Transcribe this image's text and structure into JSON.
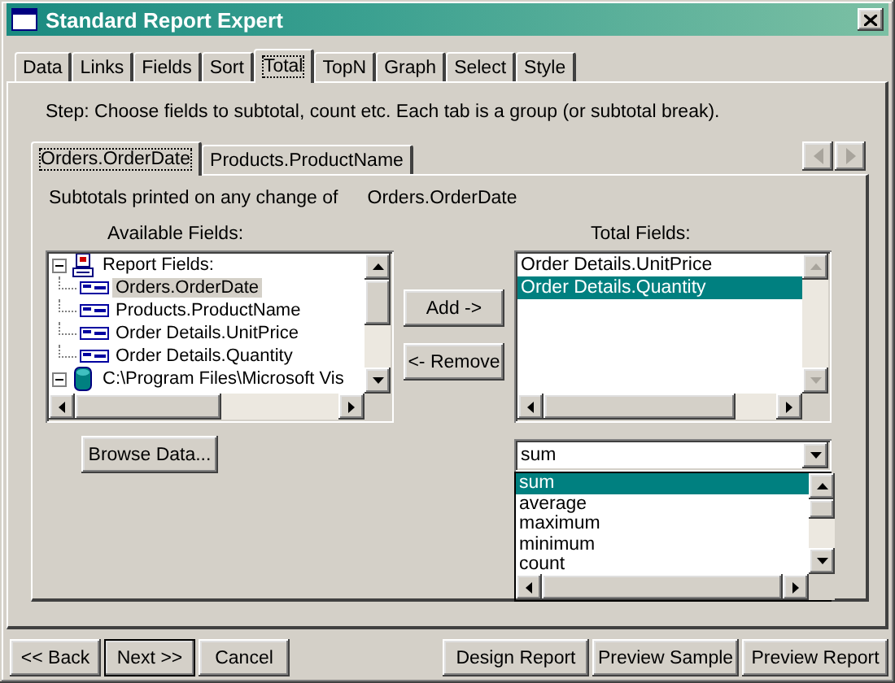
{
  "window": {
    "title": "Standard Report Expert"
  },
  "tabs": [
    {
      "label": "Data",
      "selected": false
    },
    {
      "label": "Links",
      "selected": false
    },
    {
      "label": "Fields",
      "selected": false
    },
    {
      "label": "Sort",
      "selected": false
    },
    {
      "label": "Total",
      "selected": true
    },
    {
      "label": "TopN",
      "selected": false
    },
    {
      "label": "Graph",
      "selected": false
    },
    {
      "label": "Select",
      "selected": false
    },
    {
      "label": "Style",
      "selected": false
    }
  ],
  "step_text": "Step:  Choose fields to subtotal, count etc.  Each tab is a group (or subtotal break).",
  "group_tabs": [
    {
      "label": "Orders.OrderDate",
      "selected": true
    },
    {
      "label": "Products.ProductName",
      "selected": false
    }
  ],
  "subtotals_label": "Subtotals printed on any change of",
  "subtotals_field": "Orders.OrderDate",
  "available_fields": {
    "label": "Available Fields:",
    "tree": [
      {
        "label": "Report Fields:",
        "kind": "report",
        "expanded": true,
        "children": [
          {
            "label": "Orders.OrderDate",
            "selected": true
          },
          {
            "label": "Products.ProductName",
            "selected": false
          },
          {
            "label": "Order Details.UnitPrice",
            "selected": false
          },
          {
            "label": "Order Details.Quantity",
            "selected": false
          }
        ]
      },
      {
        "label": "C:\\Program Files\\Microsoft Vis",
        "kind": "database",
        "expanded": true
      }
    ]
  },
  "add_button": "Add ->",
  "remove_button": "<- Remove",
  "browse_button": "Browse Data...",
  "total_fields": {
    "label": "Total Fields:",
    "items": [
      {
        "label": "Order Details.UnitPrice",
        "selected": false
      },
      {
        "label": "Order Details.Quantity",
        "selected": true
      }
    ]
  },
  "summary_combo": {
    "value": "sum",
    "options": [
      {
        "label": "sum",
        "selected": true
      },
      {
        "label": "average",
        "selected": false
      },
      {
        "label": "maximum",
        "selected": false
      },
      {
        "label": "minimum",
        "selected": false
      },
      {
        "label": "count",
        "selected": false
      }
    ]
  },
  "buttons": [
    {
      "label": "<< Back",
      "default": false
    },
    {
      "label": "Next >>",
      "default": true
    },
    {
      "label": "Cancel",
      "default": false
    },
    {
      "label": "Design Report",
      "default": false
    },
    {
      "label": "Preview Sample",
      "default": false
    },
    {
      "label": "Preview Report",
      "default": false
    }
  ]
}
